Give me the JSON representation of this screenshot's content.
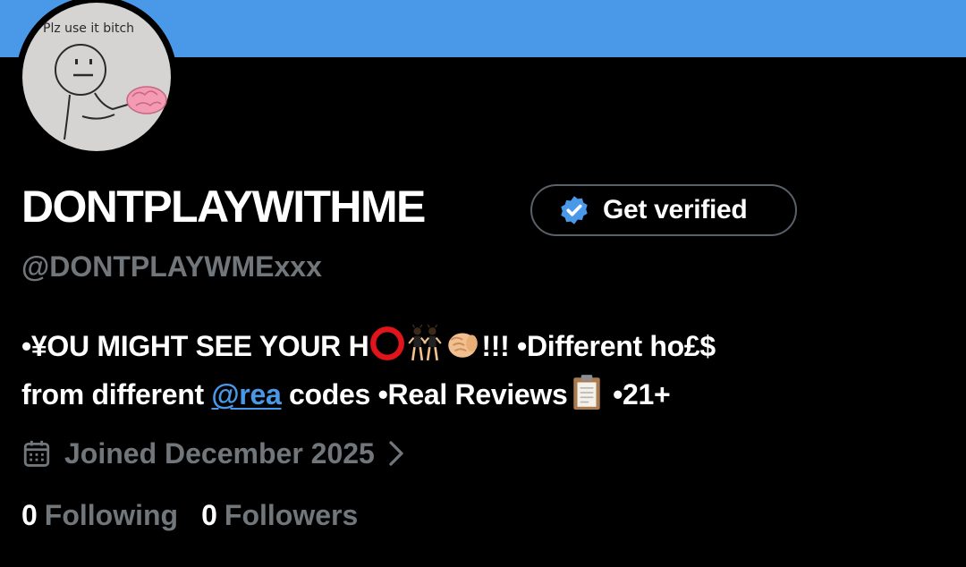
{
  "profile": {
    "avatar_caption": "Plz use it bitch",
    "display_name": "DONTPLAYWITHME",
    "handle": "@DONTPLAYWMExxx",
    "get_verified_label": "Get verified"
  },
  "bio": {
    "line1_part1": "•¥OU MIGHT SEE YOUR H",
    "line1_part2": "!!! •Different ho£$",
    "line2_part1": "from different ",
    "mention": "@rea",
    "line2_part2": " codes •Real Reviews",
    "line2_part3": " •21+"
  },
  "meta": {
    "joined": "Joined December 2025"
  },
  "stats": {
    "following_count": "0",
    "following_label": "Following",
    "followers_count": "0",
    "followers_label": "Followers"
  },
  "icons": {
    "verified": "verified-badge-icon",
    "calendar": "calendar-icon",
    "chevron": "chevron-right-icon",
    "red_circle": "red-circle-emoji-icon",
    "dancers": "dancers-emoji-icon",
    "fist": "oncoming-fist-emoji-icon",
    "clipboard": "clipboard-emoji-icon"
  },
  "colors": {
    "banner": "#4a99e9",
    "background": "#000000",
    "text_primary": "#ffffff",
    "text_secondary": "#71767b",
    "accent": "#4a99e9"
  }
}
